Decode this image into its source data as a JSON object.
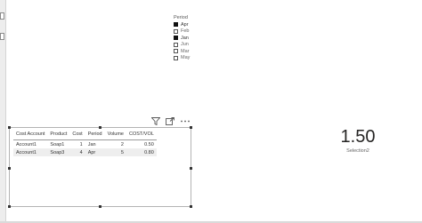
{
  "slicer": {
    "title": "Period",
    "items": [
      {
        "label": "Apr",
        "checked": true
      },
      {
        "label": "Feb",
        "checked": false
      },
      {
        "label": "Jan",
        "checked": true
      },
      {
        "label": "Jun",
        "checked": false
      },
      {
        "label": "Mar",
        "checked": false
      },
      {
        "label": "May",
        "checked": false
      }
    ]
  },
  "visual_header": {
    "icons": [
      "filter-icon",
      "focus-mode-icon",
      "more-options-icon"
    ]
  },
  "table": {
    "columns": [
      "Cost Account",
      "Product",
      "Cost",
      "Period",
      "Volume",
      "COST/VOL"
    ],
    "rows": [
      [
        "Account1",
        "Soap1",
        "1",
        "Jan",
        "2",
        "0.50"
      ],
      [
        "Account1",
        "Soap3",
        "4",
        "Apr",
        "5",
        "0.80"
      ]
    ]
  },
  "card": {
    "value": "1.50",
    "label": "Selection2"
  }
}
